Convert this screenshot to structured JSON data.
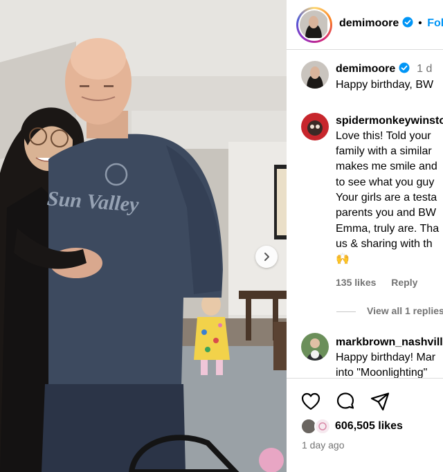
{
  "post": {
    "author": "demimoore",
    "separator": "•",
    "follow_label": "Follow"
  },
  "caption": {
    "username": "demimoore",
    "time": "1 d",
    "text": "Happy birthday, BW"
  },
  "comments": [
    {
      "username": "spidermonkeywinston",
      "lines": [
        "Love this! Told your",
        "family with a similar",
        "makes me smile and",
        "to see what you guy",
        "Your girls are a testa",
        "parents you and BW",
        "Emma, truly are. Tha",
        "us & sharing with th",
        "🙌"
      ],
      "likes": "135 likes",
      "reply_label": "Reply",
      "view_replies": "View all 1 replies"
    },
    {
      "username": "markbrown_nashville",
      "lines": [
        "Happy birthday! Mar",
        "into \"Moonlighting\""
      ]
    }
  ],
  "actions": {
    "icons": [
      "heart-icon",
      "comment-icon",
      "share-icon"
    ]
  },
  "likes_count": "606,505 likes",
  "timestamp": "1 day ago",
  "photo": {
    "shirt_text": "Sun Valley"
  },
  "colors": {
    "link": "#0095f6",
    "verified": "#0095f6",
    "muted": "#737373",
    "border": "#dbdbdb"
  }
}
